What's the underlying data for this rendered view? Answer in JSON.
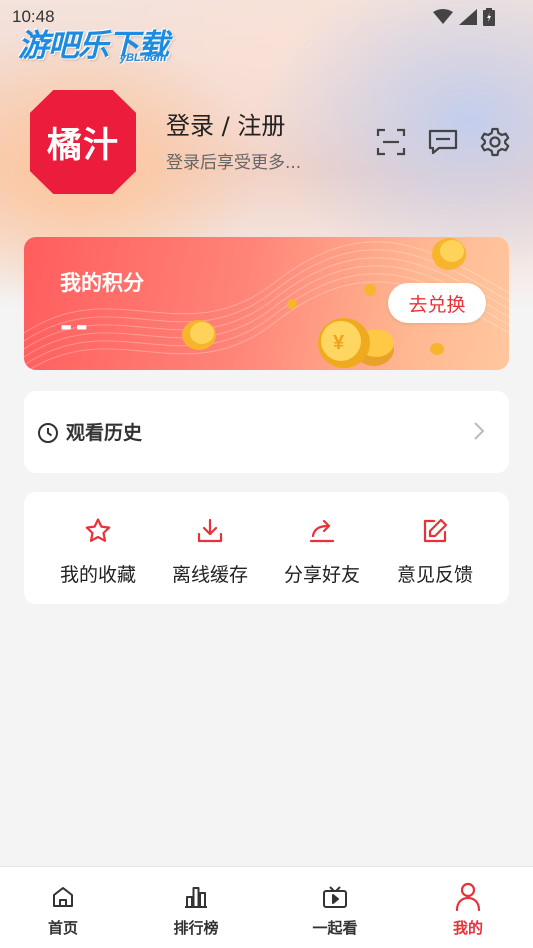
{
  "status_bar": {
    "time": "10:48"
  },
  "watermark": {
    "text": "游吧乐下载",
    "sub": "yBL.com"
  },
  "profile": {
    "avatar_text": "橘汁",
    "login_title": "登录 / 注册",
    "login_subtitle": "登录后享受更多...",
    "icons": [
      "scan-icon",
      "message-icon",
      "settings-icon"
    ]
  },
  "points": {
    "title": "我的积分",
    "value": "--",
    "redeem_label": "去兑换"
  },
  "history": {
    "label": "观看历史"
  },
  "actions": [
    {
      "label": "我的收藏",
      "icon": "star-icon"
    },
    {
      "label": "离线缓存",
      "icon": "download-icon"
    },
    {
      "label": "分享好友",
      "icon": "share-icon"
    },
    {
      "label": "意见反馈",
      "icon": "feedback-icon"
    }
  ],
  "nav": [
    {
      "label": "首页",
      "icon": "home-icon",
      "active": false
    },
    {
      "label": "排行榜",
      "icon": "chart-icon",
      "active": false
    },
    {
      "label": "一起看",
      "icon": "tv-icon",
      "active": false
    },
    {
      "label": "我的",
      "icon": "profile-icon",
      "active": true
    }
  ],
  "colors": {
    "accent": "#e8323a",
    "avatar": "#ec1c3c",
    "watermark": "#1d8be0"
  }
}
